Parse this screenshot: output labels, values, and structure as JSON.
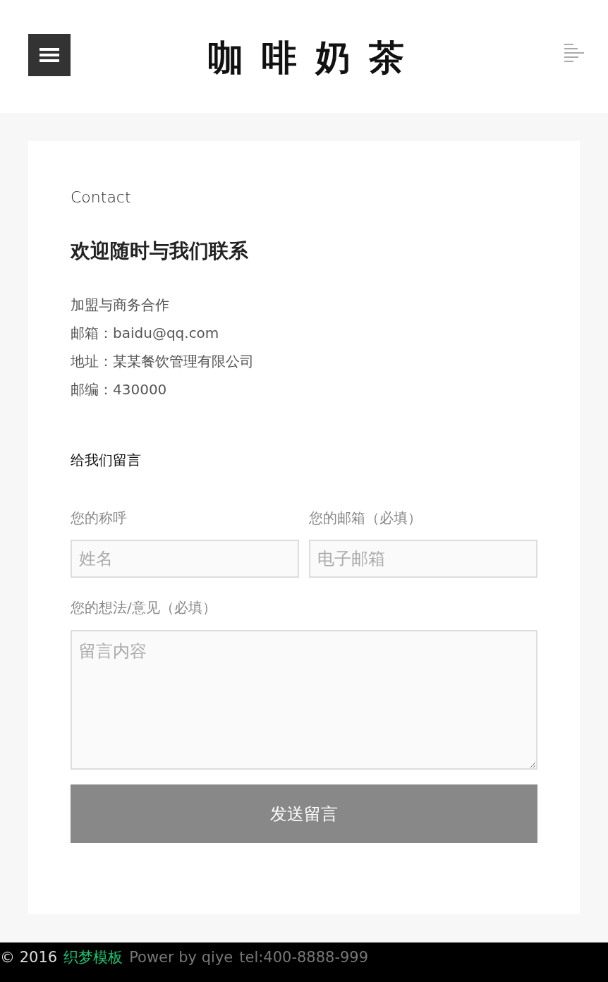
{
  "header": {
    "logo": "咖啡奶茶"
  },
  "contact": {
    "eyebrow": "Contact",
    "title": "欢迎随时与我们联系",
    "lines": [
      "加盟与商务合作",
      "邮箱：baidu@qq.com",
      "地址：某某餐饮管理有限公司",
      "邮编：430000"
    ]
  },
  "form": {
    "title": "给我们留言",
    "fields": [
      {
        "kind": "input",
        "label": "您的称呼",
        "placeholder": "姓名"
      },
      {
        "kind": "input",
        "label": "您的邮箱（必填）",
        "placeholder": "电子邮箱"
      },
      {
        "kind": "textarea",
        "label": "您的想法/意见（必填）",
        "placeholder": "留言内容"
      }
    ],
    "submit": "发送留言"
  },
  "footer": {
    "copyright": "© 2016",
    "link": "织梦模板",
    "power": "Power by qiye",
    "tel": "tel:400-8888-999"
  }
}
